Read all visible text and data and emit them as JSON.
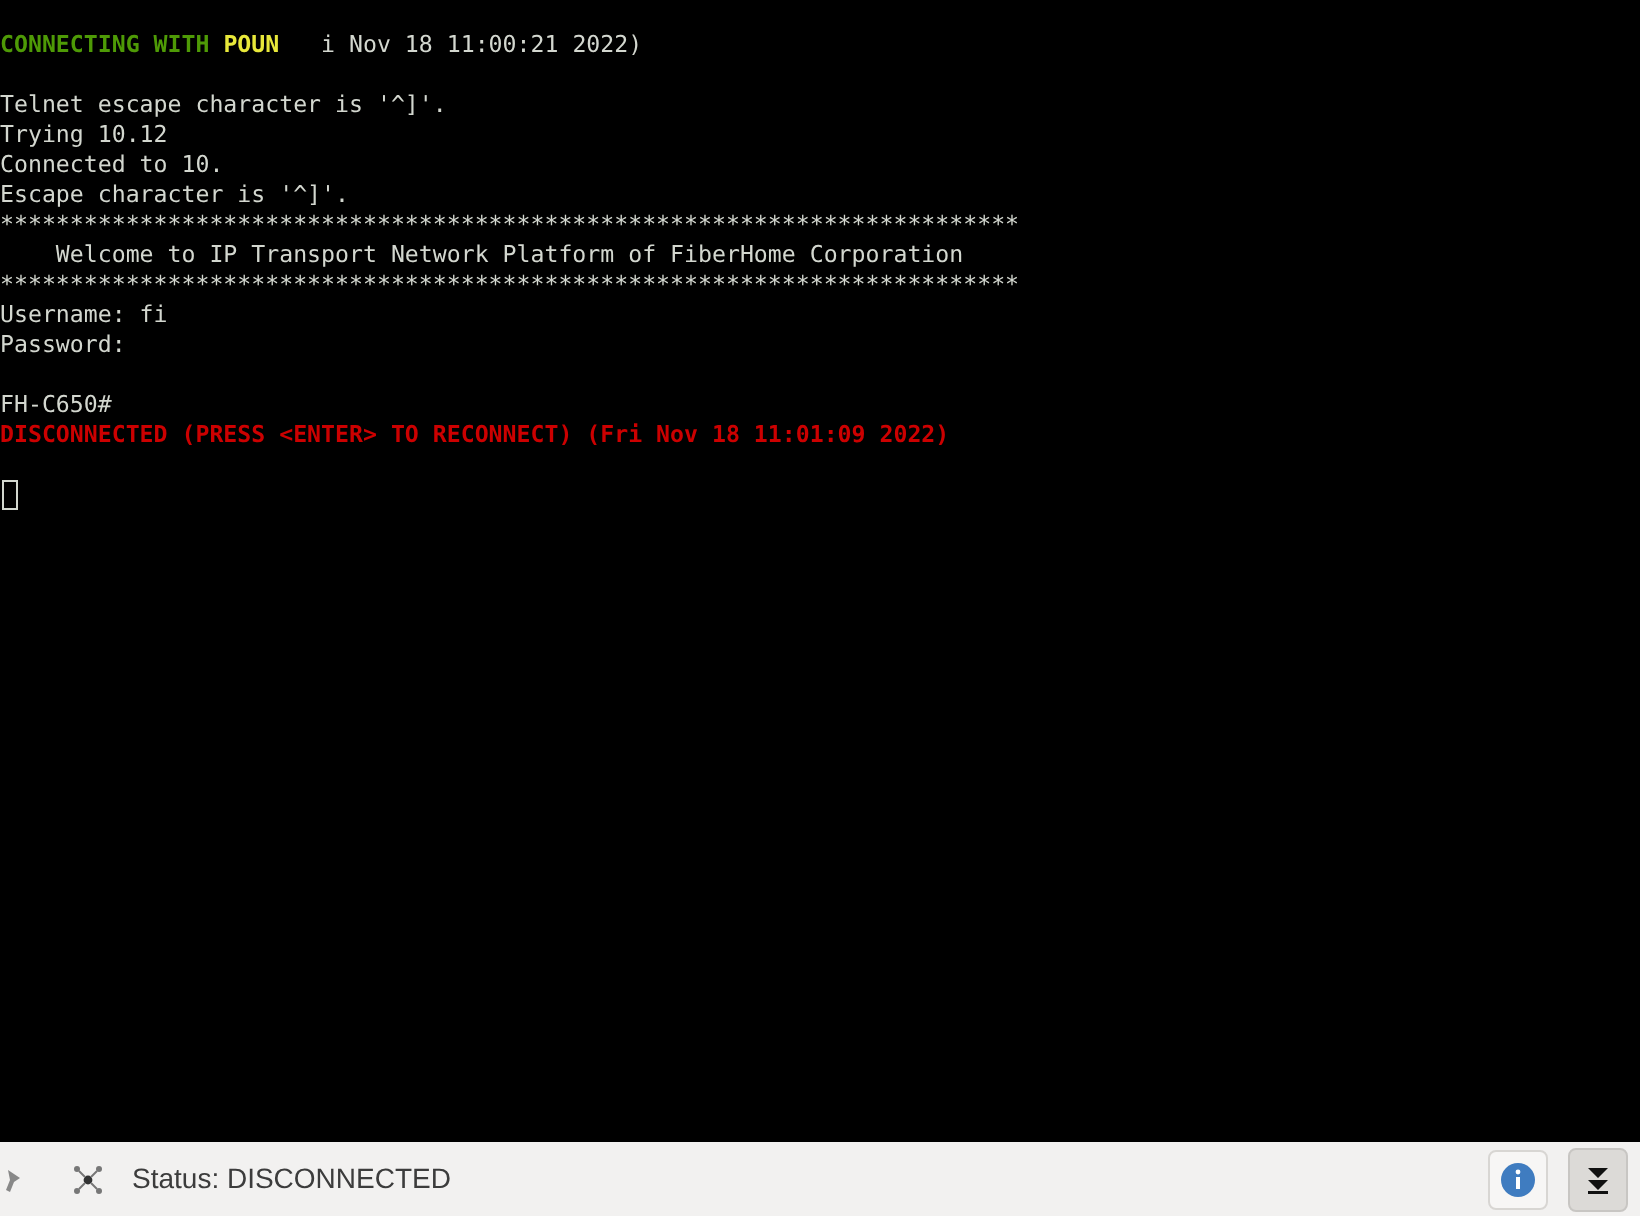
{
  "terminal": {
    "blocks": [
      {
        "lines": [
          {
            "segments": [
              {
                "kind": "connecting",
                "text": "CONNECTING WITH "
              },
              {
                "kind": "host",
                "text": "POUN"
              },
              {
                "kind": "plain",
                "text": "   i Nov 18 11:00:21 2022)"
              }
            ]
          }
        ]
      },
      {
        "lines": [
          {
            "segments": [
              {
                "kind": "plain",
                "text": "Telnet escape character is '^]'."
              }
            ]
          },
          {
            "segments": [
              {
                "kind": "plain",
                "text": "Trying 10.12"
              }
            ]
          },
          {
            "segments": [
              {
                "kind": "plain",
                "text": "Connected to 10."
              }
            ]
          },
          {
            "segments": [
              {
                "kind": "plain",
                "text": "Escape character is '^]'."
              }
            ]
          },
          {
            "segments": [
              {
                "kind": "plain",
                "text": "*************************************************************************"
              }
            ]
          },
          {
            "segments": [
              {
                "kind": "plain",
                "text": "    Welcome to IP Transport Network Platform of FiberHome Corporation"
              }
            ]
          },
          {
            "segments": [
              {
                "kind": "plain",
                "text": "*************************************************************************"
              }
            ]
          },
          {
            "segments": [
              {
                "kind": "plain",
                "text": "Username: fi"
              }
            ]
          },
          {
            "segments": [
              {
                "kind": "plain",
                "text": "Password:"
              }
            ]
          }
        ]
      },
      {
        "lines": [
          {
            "segments": [
              {
                "kind": "plain",
                "text": "FH-C650#"
              }
            ]
          },
          {
            "segments": [
              {
                "kind": "error",
                "text": "DISCONNECTED (PRESS <ENTER> TO RECONNECT) (Fri Nov 18 11:01:09 2022)"
              }
            ]
          }
        ]
      }
    ],
    "cursor": true
  },
  "status_bar": {
    "status": "Status: DISCONNECTED",
    "scroll_lock_pressed": true
  }
}
